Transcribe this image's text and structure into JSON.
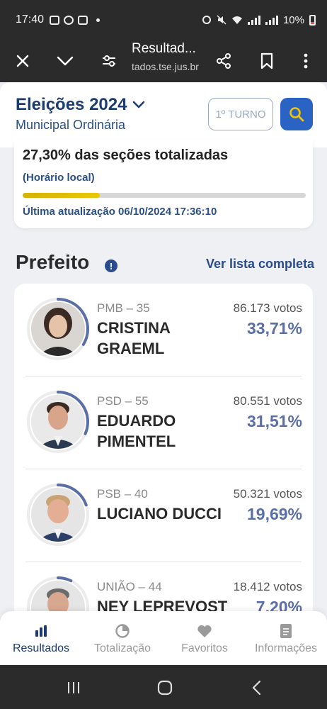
{
  "status_bar": {
    "time": "17:40",
    "battery": "10%"
  },
  "browser": {
    "title": "Resultad...",
    "url": "tados.tse.jus.br"
  },
  "header": {
    "title": "Eleições 2024",
    "subtitle": "Municipal Ordinária",
    "turno": "1º TURNO"
  },
  "progress": {
    "title": "27,30% das seções totalizadas",
    "local_time": "(Horário local)",
    "fraction": 0.273,
    "last_update": "Última atualização 06/10/2024 17:36:10"
  },
  "section": {
    "title": "Prefeito",
    "info": "!",
    "see_all": "Ver lista completa"
  },
  "candidates": [
    {
      "party": "PMB – 35",
      "name": "CRISTINA GRAEML",
      "votes": "86.173 votos",
      "percent": "33,71%",
      "share": 0.3371
    },
    {
      "party": "PSD – 55",
      "name": "EDUARDO PIMENTEL",
      "votes": "80.551 votos",
      "percent": "31,51%",
      "share": 0.3151
    },
    {
      "party": "PSB – 40",
      "name": "LUCIANO DUCCI",
      "votes": "50.321 votos",
      "percent": "19,69%",
      "share": 0.1969
    },
    {
      "party": "UNIÃO – 44",
      "name": "NEY LEPREVOST",
      "votes": "18.412 votos",
      "percent": "7,20%",
      "share": 0.072
    }
  ],
  "bottom_nav": {
    "resultados": "Resultados",
    "totalizacao": "Totalização",
    "favoritos": "Favoritos",
    "informacoes": "Informações"
  },
  "colors": {
    "accent": "#1c3b6e",
    "progress": "#e0c000",
    "percent": "#5b6fa7"
  }
}
